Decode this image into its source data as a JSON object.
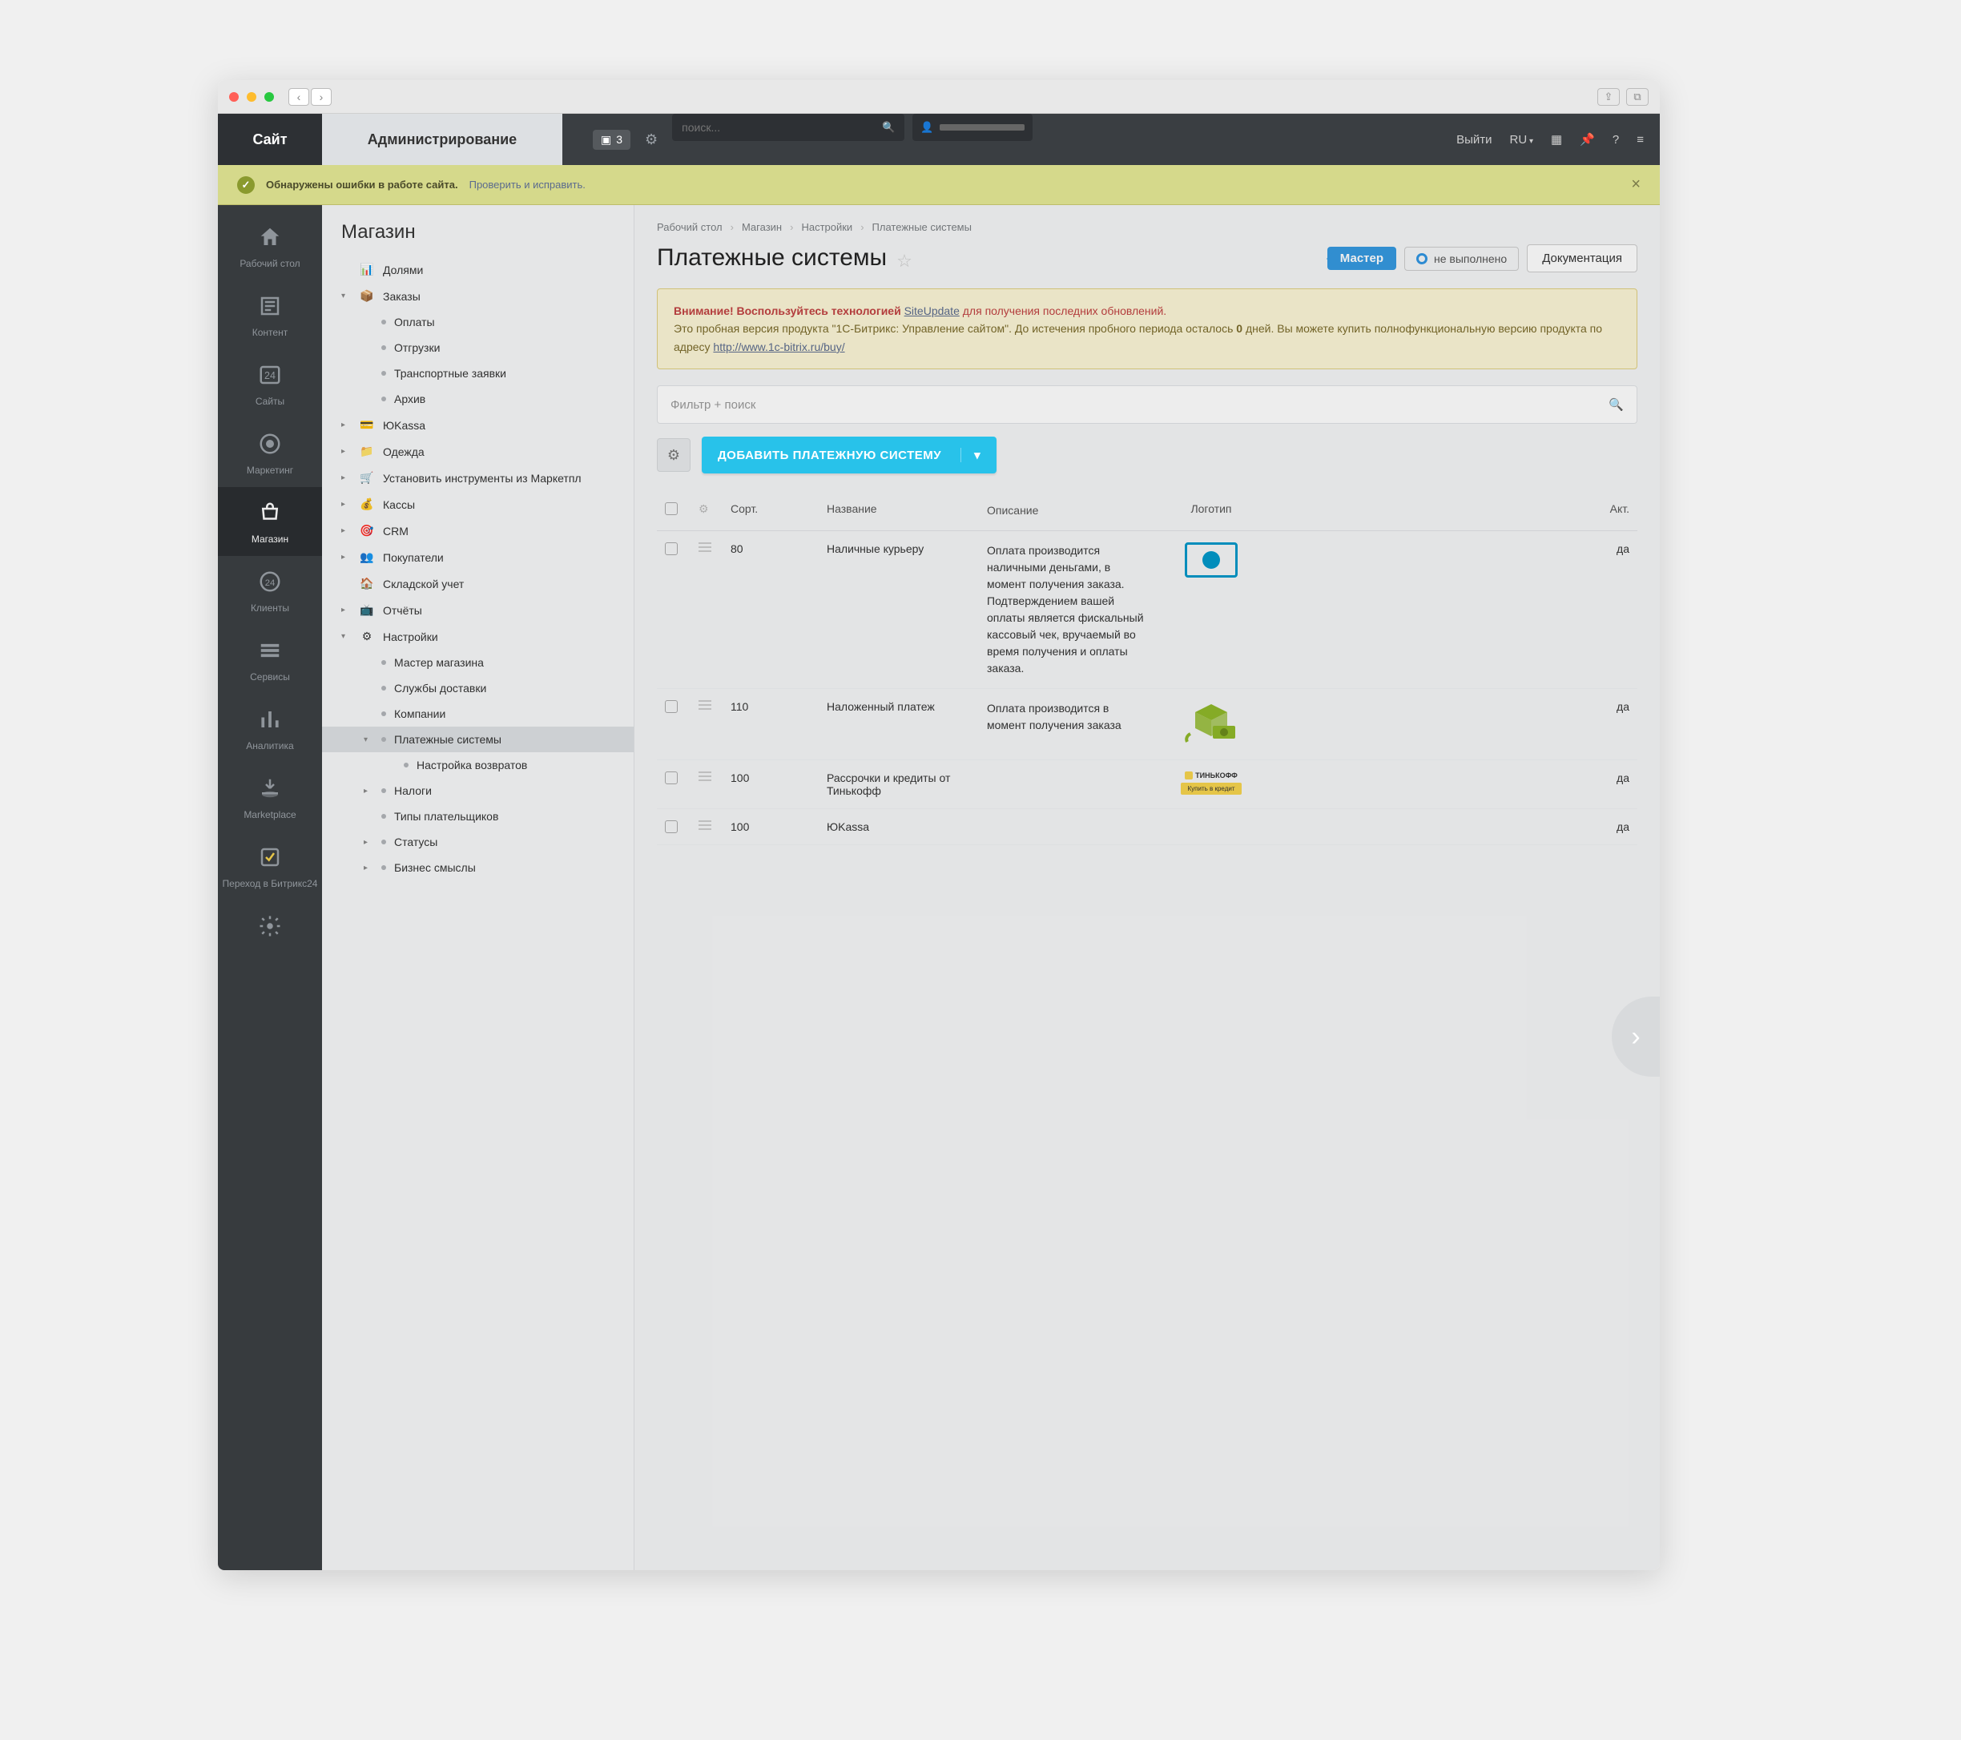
{
  "titlebar": {},
  "topbar": {
    "tab_site": "Сайт",
    "tab_admin": "Администрирование",
    "note_count": "3",
    "search_placeholder": "поиск...",
    "logout": "Выйти",
    "lang": "RU"
  },
  "alert": {
    "message": "Обнаружены ошибки в работе сайта.",
    "action": "Проверить и исправить."
  },
  "sidebar": [
    {
      "id": "desktop",
      "label": "Рабочий стол"
    },
    {
      "id": "content",
      "label": "Контент"
    },
    {
      "id": "sites",
      "label": "Сайты"
    },
    {
      "id": "marketing",
      "label": "Маркетинг"
    },
    {
      "id": "shop",
      "label": "Магазин",
      "active": true
    },
    {
      "id": "clients",
      "label": "Клиенты"
    },
    {
      "id": "services",
      "label": "Сервисы"
    },
    {
      "id": "analytics",
      "label": "Аналитика"
    },
    {
      "id": "marketplace",
      "label": "Marketplace"
    },
    {
      "id": "bitrix24",
      "label": "Переход в Битрикс24"
    },
    {
      "id": "settings",
      "label": ""
    }
  ],
  "tree": {
    "title": "Магазин",
    "items": [
      {
        "lvl": 1,
        "icon": "chart",
        "label": "Долями",
        "arrow": ""
      },
      {
        "lvl": 1,
        "icon": "box",
        "label": "Заказы",
        "arrow": "▾"
      },
      {
        "lvl": 2,
        "dot": true,
        "label": "Оплаты"
      },
      {
        "lvl": 2,
        "dot": true,
        "label": "Отгрузки"
      },
      {
        "lvl": 2,
        "dot": true,
        "label": "Транспортные заявки"
      },
      {
        "lvl": 2,
        "dot": true,
        "label": "Архив"
      },
      {
        "lvl": 1,
        "icon": "ykassa",
        "label": "ЮKassa",
        "arrow": "▸"
      },
      {
        "lvl": 1,
        "icon": "folder",
        "label": "Одежда",
        "arrow": "▸"
      },
      {
        "lvl": 1,
        "icon": "cart",
        "label": "Установить инструменты из Маркетпл",
        "arrow": "▸"
      },
      {
        "lvl": 1,
        "icon": "kass",
        "label": "Кассы",
        "arrow": "▸"
      },
      {
        "lvl": 1,
        "icon": "crm",
        "label": "CRM",
        "arrow": "▸"
      },
      {
        "lvl": 1,
        "icon": "users",
        "label": "Покупатели",
        "arrow": "▸"
      },
      {
        "lvl": 1,
        "icon": "house",
        "label": "Складской учет",
        "arrow": ""
      },
      {
        "lvl": 1,
        "icon": "report",
        "label": "Отчёты",
        "arrow": "▸"
      },
      {
        "lvl": 1,
        "icon": "settings",
        "label": "Настройки",
        "arrow": "▾"
      },
      {
        "lvl": 2,
        "dot": true,
        "label": "Мастер магазина"
      },
      {
        "lvl": 2,
        "dot": true,
        "label": "Службы доставки"
      },
      {
        "lvl": 2,
        "dot": true,
        "label": "Компании"
      },
      {
        "lvl": 2,
        "dot": true,
        "label": "Платежные системы",
        "arrow": "▾",
        "selected": true
      },
      {
        "lvl": 3,
        "dot": true,
        "label": "Настройка возвратов"
      },
      {
        "lvl": 2,
        "dot": true,
        "label": "Налоги",
        "arrow": "▸"
      },
      {
        "lvl": 2,
        "dot": true,
        "label": "Типы плательщиков"
      },
      {
        "lvl": 2,
        "dot": true,
        "label": "Статусы",
        "arrow": "▸"
      },
      {
        "lvl": 2,
        "dot": true,
        "label": "Бизнес смыслы",
        "arrow": "▸"
      }
    ]
  },
  "breadcrumb": [
    "Рабочий стол",
    "Магазин",
    "Настройки",
    "Платежные системы"
  ],
  "page": {
    "title": "Платежные системы",
    "master": "Мастер",
    "status": "не выполнено",
    "doc_btn": "Документация"
  },
  "trial": {
    "line1_a": "Внимание! Воспользуйтесь технологией ",
    "line1_link": "SiteUpdate",
    "line1_b": " для получения последних обновлений.",
    "line2": "Это пробная версия продукта \"1С-Битрикс: Управление сайтом\". До истечения пробного периода осталось ",
    "line2_days": "0",
    "line2_b": " дней. Вы можете купить полнофункциональную версию продукта по адресу ",
    "line2_url": "http://www.1c-bitrix.ru/buy/"
  },
  "filter_placeholder": "Фильтр + поиск",
  "add_button": "ДОБАВИТЬ ПЛАТЕЖНУЮ СИСТЕМУ",
  "table": {
    "headers": {
      "sort": "Сорт.",
      "name": "Название",
      "desc": "Описание",
      "logo": "Логотип",
      "act": "Акт."
    },
    "rows": [
      {
        "sort": "80",
        "name": "Наличные курьеру",
        "desc": "Оплата производится наличными деньгами, в момент получения заказа. Подтверждением вашей оплаты является фискальный кассовый чек, вручаемый во время получения и оплаты заказа.",
        "logo": "cash",
        "active": "да"
      },
      {
        "sort": "110",
        "name": "Наложенный платеж",
        "desc": "Оплата производится в момент получения заказа",
        "logo": "crate",
        "active": "да"
      },
      {
        "sort": "100",
        "name": "Рассрочки и кредиты от Тинькофф",
        "desc": "",
        "logo": "tinkoff",
        "active": "да"
      },
      {
        "sort": "100",
        "name": "ЮKassa",
        "desc": "",
        "logo": "",
        "active": "да"
      }
    ],
    "tinkoff_label": "ТИНЬКОФФ",
    "tinkoff_sub": "Купить в кредит"
  }
}
